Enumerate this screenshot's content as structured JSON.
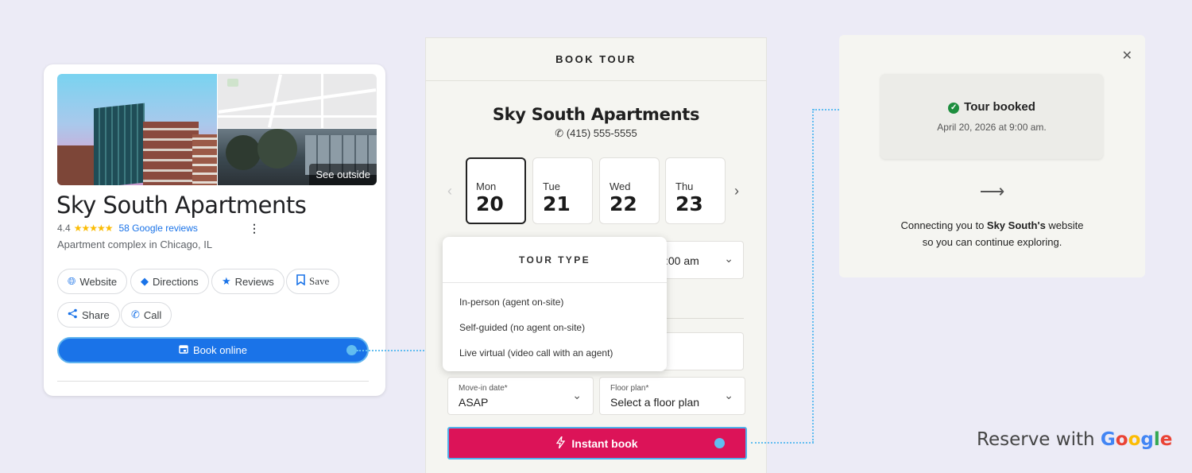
{
  "listing": {
    "title": "Sky South Apartments",
    "rating": "4.4",
    "stars": "★★★★★",
    "reviews_link": "58 Google reviews",
    "subtitle": "Apartment complex in Chicago, IL",
    "see_outside": "See outside",
    "actions": {
      "website": "Website",
      "directions": "Directions",
      "reviews": "Reviews",
      "save": "Save",
      "share": "Share",
      "call": "Call"
    },
    "book_online": "Book online"
  },
  "tour": {
    "header": "BOOK TOUR",
    "title": "Sky South Apartments",
    "phone": "(415) 555-5555",
    "days": [
      {
        "name": "Mon",
        "date": "20",
        "selected": true
      },
      {
        "name": "Tue",
        "date": "21",
        "selected": false
      },
      {
        "name": "Wed",
        "date": "22",
        "selected": false
      },
      {
        "name": "Thu",
        "date": "23",
        "selected": false
      }
    ],
    "time_partial": ":00 am",
    "move_in": {
      "label": "Move-in date*",
      "value": "ASAP"
    },
    "floor_plan": {
      "label": "Floor plan*",
      "value": "Select a floor plan"
    },
    "instant_book": "Instant book",
    "accent_color": "#dc1358"
  },
  "tour_type": {
    "header": "TOUR TYPE",
    "options": [
      "In-person (agent on-site)",
      "Self-guided (no agent on-site)",
      "Live virtual (video call with an agent)"
    ]
  },
  "confirmation": {
    "title": "Tour booked",
    "date": "April 20, 2026 at 9:00 am.",
    "message_prefix": "Connecting you to ",
    "message_brand": "Sky South's",
    "message_suffix": " website",
    "message_line2": "so you can continue exploring."
  },
  "branding": {
    "prefix": "Reserve with ",
    "google": [
      "G",
      "o",
      "o",
      "g",
      "l",
      "e"
    ],
    "google_colors": [
      "#4285f4",
      "#ea4335",
      "#fbbc04",
      "#4285f4",
      "#34a853",
      "#ea4335"
    ]
  },
  "colors": {
    "google_blue": "#1a73e8",
    "connector": "#62bdf0",
    "background": "#ecebf6"
  }
}
